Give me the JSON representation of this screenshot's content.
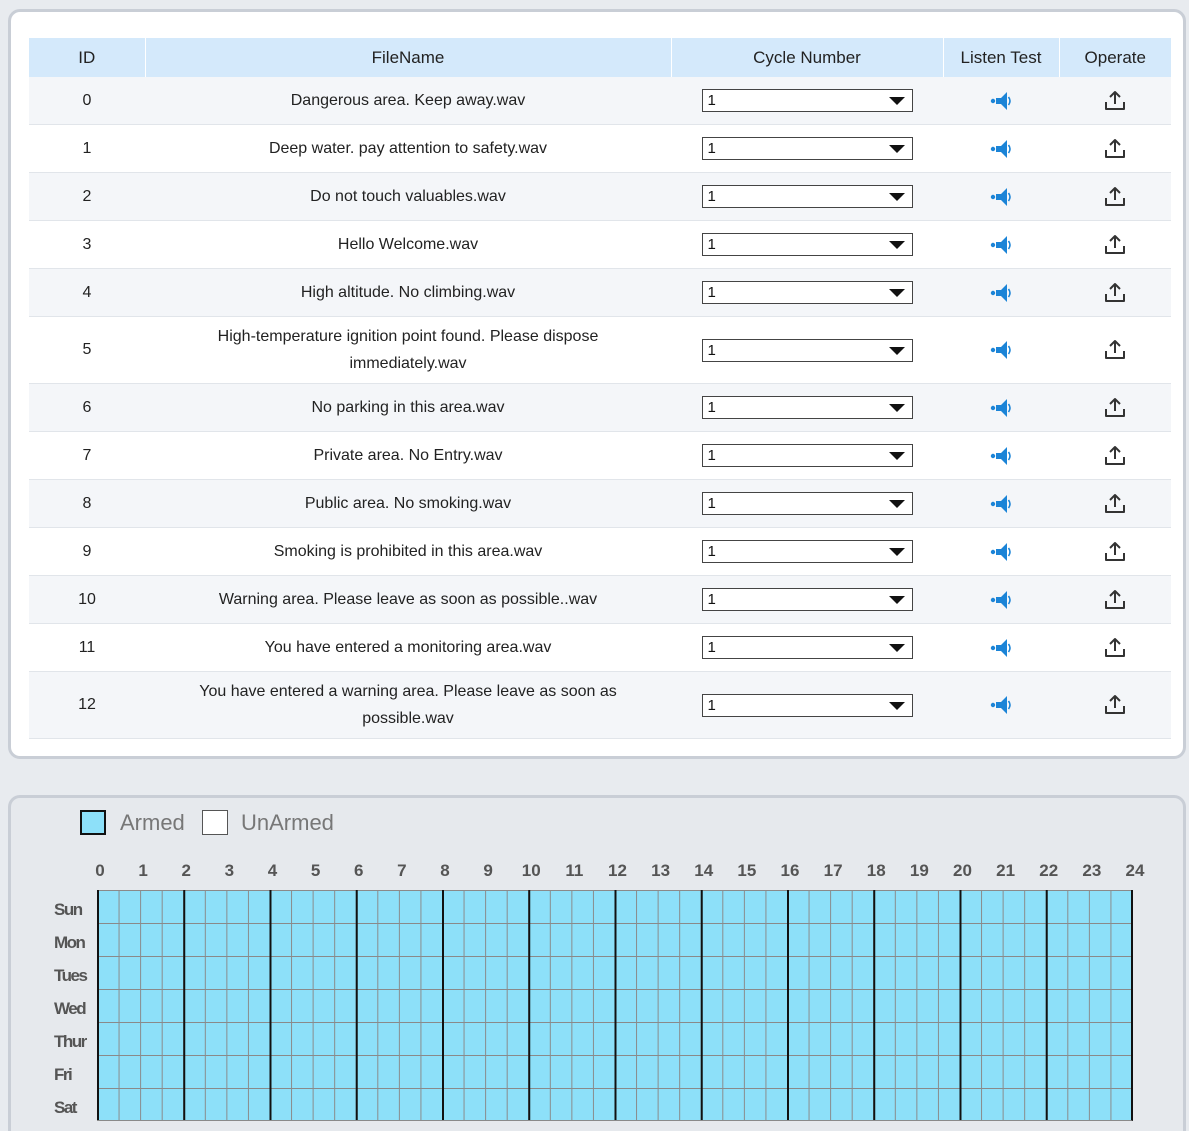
{
  "table": {
    "headers": {
      "id": "ID",
      "filename": "FileName",
      "cycle": "Cycle Number",
      "listen": "Listen Test",
      "operate": "Operate"
    },
    "rows": [
      {
        "id": "0",
        "filename": "Dangerous area. Keep away.wav",
        "cycle": "1"
      },
      {
        "id": "1",
        "filename": "Deep water. pay attention to safety.wav",
        "cycle": "1"
      },
      {
        "id": "2",
        "filename": "Do not touch valuables.wav",
        "cycle": "1"
      },
      {
        "id": "3",
        "filename": "Hello Welcome.wav",
        "cycle": "1"
      },
      {
        "id": "4",
        "filename": "High altitude. No climbing.wav",
        "cycle": "1"
      },
      {
        "id": "5",
        "filename": "High-temperature ignition point found. Please dispose immediately.wav",
        "cycle": "1"
      },
      {
        "id": "6",
        "filename": "No parking in this area.wav",
        "cycle": "1"
      },
      {
        "id": "7",
        "filename": "Private area. No Entry.wav",
        "cycle": "1"
      },
      {
        "id": "8",
        "filename": "Public area. No smoking.wav",
        "cycle": "1"
      },
      {
        "id": "9",
        "filename": "Smoking is prohibited in this area.wav",
        "cycle": "1"
      },
      {
        "id": "10",
        "filename": "Warning area. Please leave as soon as possible..wav",
        "cycle": "1"
      },
      {
        "id": "11",
        "filename": "You have entered a monitoring area.wav",
        "cycle": "1"
      },
      {
        "id": "12",
        "filename": "You have entered a warning area. Please leave as soon as possible.wav",
        "cycle": "1"
      }
    ]
  },
  "schedule": {
    "legend": {
      "armed": "Armed",
      "unarmed": "UnArmed"
    },
    "hours": [
      "0",
      "1",
      "2",
      "3",
      "4",
      "5",
      "6",
      "7",
      "8",
      "9",
      "10",
      "11",
      "12",
      "13",
      "14",
      "15",
      "16",
      "17",
      "18",
      "19",
      "20",
      "21",
      "22",
      "23",
      "24"
    ],
    "days": [
      "Sun",
      "Mon",
      "Tues",
      "Wed",
      "Thur",
      "Fri",
      "Sat"
    ],
    "state": "all-armed"
  },
  "colors": {
    "header_bg": "#d4e9fb",
    "armed": "#8de0f9",
    "unarmed": "#ffffff",
    "icon_blue": "#1b84d7"
  },
  "icons": {
    "listen": "speaker-icon",
    "operate": "upload-icon"
  }
}
